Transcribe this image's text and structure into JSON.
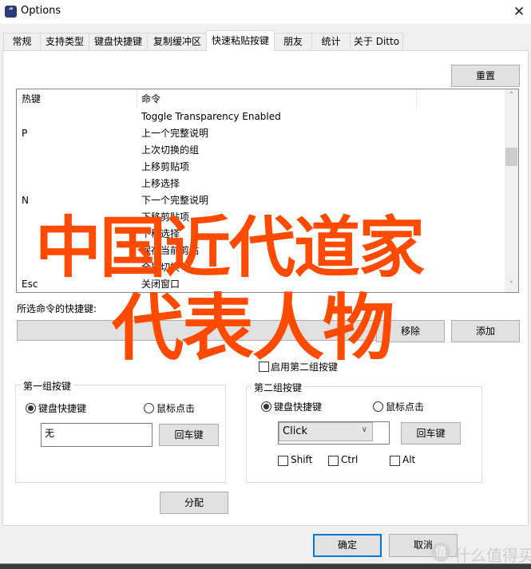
{
  "window": {
    "title": "Options",
    "app_icon_glyph": "”",
    "close_glyph": "✕"
  },
  "tabs": [
    {
      "label": "常规",
      "active": false
    },
    {
      "label": "支持类型",
      "active": false
    },
    {
      "label": "键盘快捷键",
      "active": false
    },
    {
      "label": "复制缓冲区",
      "active": false
    },
    {
      "label": "快速粘贴按键",
      "active": true
    },
    {
      "label": "朋友",
      "active": false
    },
    {
      "label": "统计",
      "active": false
    },
    {
      "label": "关于 Ditto",
      "active": false
    }
  ],
  "toolbar": {
    "reset_label": "重置"
  },
  "hotkey_list": {
    "columns": [
      "热键",
      "命令"
    ],
    "rows": [
      {
        "hotkey": "",
        "command": "Toggle Transparency Enabled"
      },
      {
        "hotkey": "P",
        "command": "上一个完整说明"
      },
      {
        "hotkey": "",
        "command": "上次切换的组"
      },
      {
        "hotkey": "",
        "command": "上移剪贴项"
      },
      {
        "hotkey": "",
        "command": "上移选择"
      },
      {
        "hotkey": "N",
        "command": "下一个完整说明"
      },
      {
        "hotkey": "",
        "command": "下移剪贴项"
      },
      {
        "hotkey": "",
        "command": "下移选择"
      },
      {
        "hotkey": "",
        "command": "保存当前剪贴"
      },
      {
        "hotkey": "",
        "command": "全屏切换"
      },
      {
        "hotkey": "Esc",
        "command": "关闭窗口"
      }
    ],
    "scroll_up_glyph": "˄",
    "scroll_down_glyph": "˅"
  },
  "shortcut_section": {
    "label": "所选命令的快捷键:",
    "value": "",
    "remove_label": "移除",
    "add_label": "添加",
    "enable_second_group_label": "启用第二组按键",
    "enable_second_group_checked": false
  },
  "group1": {
    "title": "第一组按键",
    "radio_keyboard": "键盘快捷键",
    "radio_mouse": "鼠标点击",
    "selected": "keyboard",
    "key_value": "无",
    "enter_label": "回车键"
  },
  "group2": {
    "title": "第二组按键",
    "radio_keyboard": "键盘快捷键",
    "radio_mouse": "鼠标点击",
    "selected": "keyboard",
    "combo_value": "Click",
    "combo_arrow": "∨",
    "enter_label": "回车键",
    "shift_label": "Shift",
    "ctrl_label": "Ctrl",
    "alt_label": "Alt",
    "shift_checked": false,
    "ctrl_checked": false,
    "alt_checked": false
  },
  "assign_label": "分配",
  "footer": {
    "ok_label": "确定",
    "cancel_label": "取消"
  },
  "overlay": {
    "line1": "中国近代道家",
    "line2": "代表人物",
    "color": "#ff4a00"
  },
  "watermark": {
    "icon_glyph": "值",
    "text": "什么值得买"
  }
}
